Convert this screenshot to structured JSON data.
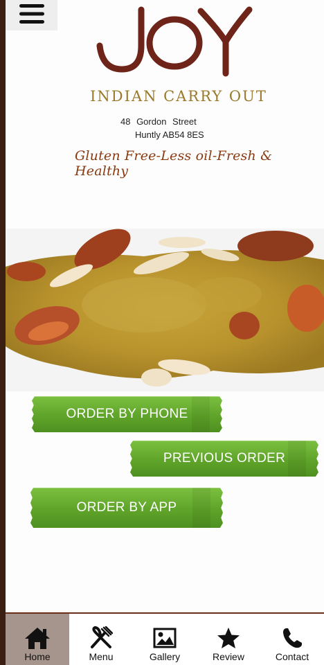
{
  "header": {
    "menu_icon": "hamburger-icon",
    "logo_text": "JOY",
    "subtitle": "INDIAN CARRY OUT"
  },
  "address": {
    "line1": "48 Gordon Street",
    "line2": "Huntly AB54 8ES"
  },
  "tagline": "Gluten Free-Less oil-Fresh & Healthy",
  "hero": {
    "image": "chicken-curry-photo"
  },
  "buttons": {
    "order_phone": "ORDER BY PHONE",
    "previous_order": "PREVIOUS ORDER",
    "order_app": "ORDER BY APP"
  },
  "tabs": [
    {
      "label": "Home",
      "icon": "home-icon",
      "active": true
    },
    {
      "label": "Menu",
      "icon": "fork-knife-icon",
      "active": false
    },
    {
      "label": "Gallery",
      "icon": "image-icon",
      "active": false
    },
    {
      "label": "Review",
      "icon": "star-icon",
      "active": false
    },
    {
      "label": "Contact",
      "icon": "phone-icon",
      "active": false
    }
  ],
  "colors": {
    "logo": "#6e2418",
    "subtitle": "#9a7a2a",
    "tagline": "#8a3a10",
    "button_green": "#6ab334",
    "tab_active": "#a5958d"
  }
}
